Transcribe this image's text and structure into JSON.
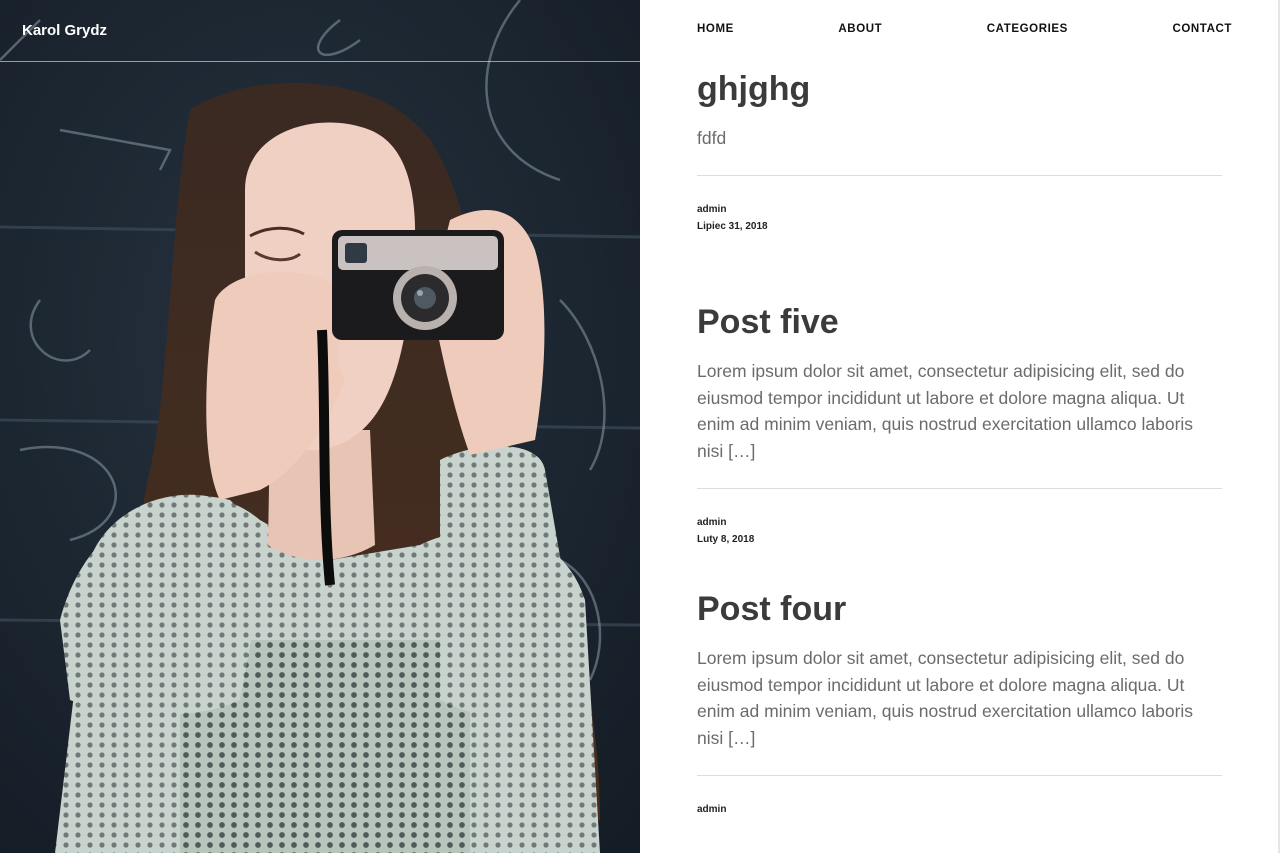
{
  "site": {
    "title": "Karol Grydz"
  },
  "nav": {
    "items": [
      {
        "label": "HOME"
      },
      {
        "label": "ABOUT"
      },
      {
        "label": "CATEGORIES"
      },
      {
        "label": "CONTACT"
      }
    ]
  },
  "posts": [
    {
      "title": "ghjghg",
      "excerpt": "fdfd",
      "author": "admin",
      "date": "Lipiec 31, 2018"
    },
    {
      "title": "Post five",
      "excerpt": "Lorem ipsum dolor sit amet, consectetur adipisicing elit, sed do eiusmod tempor incididunt ut labore et dolore magna aliqua. Ut enim ad minim veniam, quis nostrud exercitation ullamco laboris nisi […]",
      "author": "admin",
      "date": "Luty 8, 2018"
    },
    {
      "title": "Post four",
      "excerpt": "Lorem ipsum dolor sit amet, consectetur adipisicing elit, sed do eiusmod tempor incididunt ut labore et dolore magna aliqua. Ut enim ad minim veniam, quis nostrud exercitation ullamco laboris nisi […]",
      "author": "admin"
    }
  ],
  "colors": {
    "heading": "#3b3b3b",
    "body_text": "#6b6b6b",
    "rule": "#dddddd",
    "hero_background": "#1c2733"
  },
  "hero_image": {
    "icon": "photo-woman-holding-camera"
  }
}
